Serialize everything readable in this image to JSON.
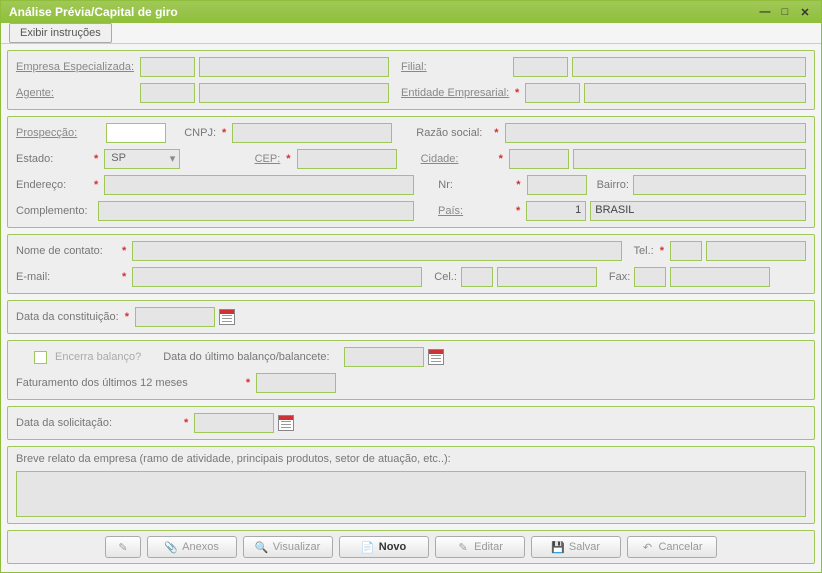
{
  "window": {
    "title": "Análise Prévia/Capital de giro"
  },
  "toolbar": {
    "instructions": "Exibir instruções"
  },
  "section1": {
    "empresa_especializada": {
      "label": "Empresa Especializada:",
      "value": ""
    },
    "filial": {
      "label": "Filial:",
      "value1": "",
      "value2": ""
    },
    "agente": {
      "label": "Agente:",
      "value": ""
    },
    "entidade": {
      "label": "Entidade Empresarial:",
      "value1": "",
      "value2": ""
    }
  },
  "section2": {
    "prospeccao": {
      "label": "Prospecção:",
      "value": ""
    },
    "cnpj": {
      "label": "CNPJ:",
      "value": ""
    },
    "razao": {
      "label": "Razão social:",
      "value": ""
    },
    "estado": {
      "label": "Estado:",
      "value": "SP"
    },
    "cep": {
      "label": "CEP:",
      "value": ""
    },
    "cidade": {
      "label": "Cidade:",
      "value1": "",
      "value2": ""
    },
    "endereco": {
      "label": "Endereço:",
      "value": ""
    },
    "nr": {
      "label": "Nr:",
      "value": ""
    },
    "bairro": {
      "label": "Bairro:",
      "value": ""
    },
    "complemento": {
      "label": "Complemento:",
      "value": ""
    },
    "pais": {
      "label": "País:",
      "code": "1",
      "name": "BRASIL"
    }
  },
  "section3": {
    "nome_contato": {
      "label": "Nome de contato:",
      "value": ""
    },
    "tel": {
      "label": "Tel.:",
      "ddd": "",
      "num": ""
    },
    "email": {
      "label": "E-mail:",
      "value": ""
    },
    "cel": {
      "label": "Cel.:",
      "ddd": "",
      "num": ""
    },
    "fax": {
      "label": "Fax:",
      "ddd": "",
      "num": ""
    }
  },
  "section4": {
    "data_const": {
      "label": "Data da constituição:",
      "value": ""
    }
  },
  "section5": {
    "encerra": {
      "label": "Encerra balanço?"
    },
    "data_balanco": {
      "label": "Data do último balanço/balancete:",
      "value": ""
    },
    "faturamento": {
      "label": "Faturamento dos últimos 12 meses",
      "value": ""
    }
  },
  "section6": {
    "data_solic": {
      "label": "Data da solicitação:",
      "value": ""
    }
  },
  "section7": {
    "relato": {
      "label": "Breve relato da empresa (ramo de atividade, principais produtos, setor de atuação, etc..):",
      "value": ""
    }
  },
  "buttons": {
    "anexos": "Anexos",
    "visualizar": "Visualizar",
    "novo": "Novo",
    "editar": "Editar",
    "salvar": "Salvar",
    "cancelar": "Cancelar"
  }
}
